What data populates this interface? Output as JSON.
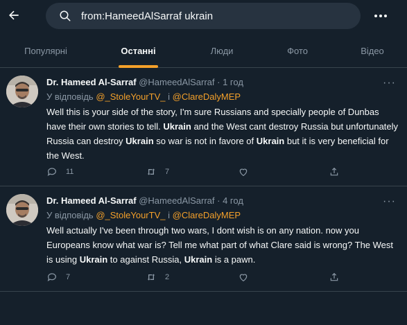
{
  "search": {
    "value": "from:HameedAlSarraf ukrain"
  },
  "tabs": [
    {
      "label": "Популярні"
    },
    {
      "label": "Останні"
    },
    {
      "label": "Люди"
    },
    {
      "label": "Фото"
    },
    {
      "label": "Відео"
    }
  ],
  "tweets": [
    {
      "name": "Dr. Hameed Al-Sarraf",
      "handle": "@HameedAlSarraf",
      "dot": "·",
      "time": "1 год",
      "reply_prefix": "У відповідь",
      "mention1": "@_StoleYourTV_",
      "reply_join": "і",
      "mention2": "@ClareDalyMEP",
      "text": [
        "Well this is your side of the story, I'm sure Russians and specially people of Dunbas have their own stories to tell. ",
        "Ukrain",
        " and the West cant destroy Russia but unfortunately Russia can destroy ",
        "Ukrain",
        " so war is not in favore of ",
        "Ukrain",
        " but it is very beneficial for the West."
      ],
      "replies": "11",
      "retweets": "7",
      "likes": "",
      "more": "···"
    },
    {
      "name": "Dr. Hameed Al-Sarraf",
      "handle": "@HameedAlSarraf",
      "dot": "·",
      "time": "4 год",
      "reply_prefix": "У відповідь",
      "mention1": "@_StoleYourTV_",
      "reply_join": "і",
      "mention2": "@ClareDalyMEP",
      "text": [
        "Well actually I've been through two wars, I dont wish is on any nation. now you Europeans know what war is? Tell me what part of what Clare said is wrong? The West is using ",
        "Ukrain",
        " to against Russia, ",
        "Ukrain",
        " is a pawn."
      ],
      "replies": "7",
      "retweets": "2",
      "likes": "",
      "more": "···"
    }
  ],
  "colors": {
    "background": "#15202b",
    "accent": "#f4a02a",
    "muted": "#8b98a5",
    "border": "#38444d"
  },
  "icons": [
    "back-arrow-icon",
    "search-icon",
    "more-icon",
    "reply-icon",
    "retweet-icon",
    "like-icon",
    "share-icon"
  ]
}
